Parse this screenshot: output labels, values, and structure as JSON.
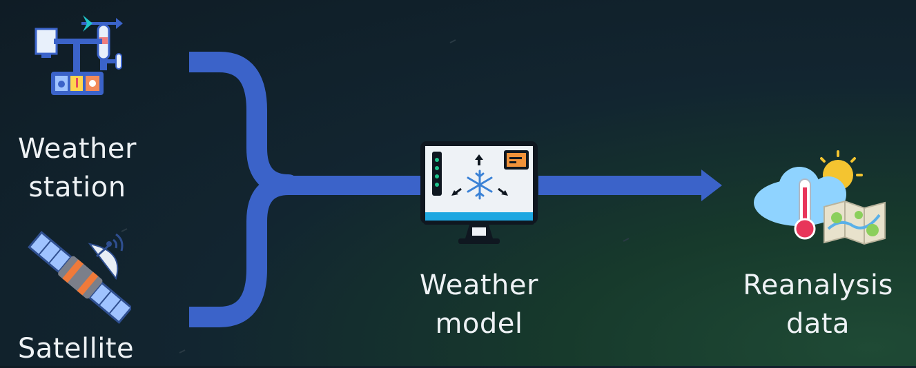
{
  "nodes": {
    "weather_station": {
      "line1": "Weather",
      "line2": "station"
    },
    "satellite": {
      "line1": "Satellite"
    },
    "weather_model": {
      "line1": "Weather",
      "line2": "model"
    },
    "reanalysis": {
      "line1": "Reanalysis",
      "line2": "data"
    }
  },
  "colors": {
    "arrow": "#3b63c9",
    "label_text": "#eef2f5"
  },
  "icons": [
    "weather-station-icon",
    "satellite-icon",
    "computer-snowflake-icon",
    "thermometer-cloud-map-icon"
  ]
}
